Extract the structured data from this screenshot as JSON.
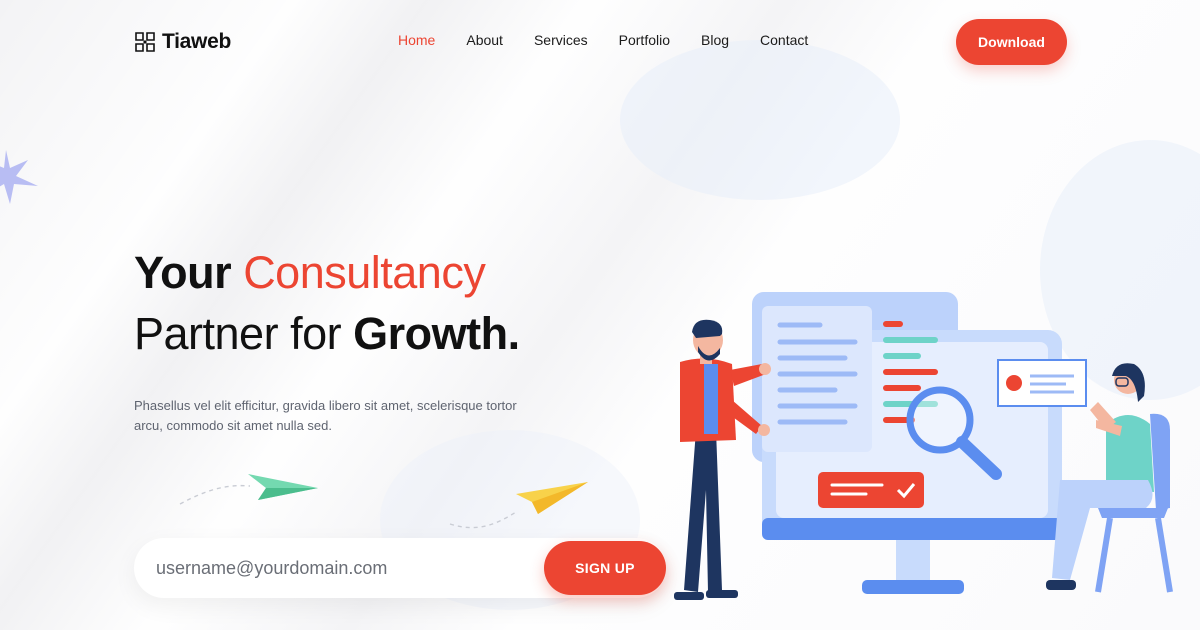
{
  "brand": {
    "name": "Tiaweb"
  },
  "nav": {
    "items": [
      {
        "label": "Home",
        "active": true
      },
      {
        "label": "About",
        "active": false
      },
      {
        "label": "Services",
        "active": false
      },
      {
        "label": "Portfolio",
        "active": false
      },
      {
        "label": "Blog",
        "active": false
      },
      {
        "label": "Contact",
        "active": false
      }
    ],
    "download_label": "Download"
  },
  "hero": {
    "headline_line1_a": "Your",
    "headline_line1_b": "Consultancy",
    "headline_line2_a": "Partner for",
    "headline_line2_b": "Growth.",
    "subtext": "Phasellus vel elit efficitur, gravida libero sit amet, scelerisque tortor arcu, commodo sit amet nulla sed."
  },
  "signup": {
    "placeholder": "username@yourdomain.com",
    "button_label": "SIGN UP"
  },
  "colors": {
    "accent": "#ec4532",
    "text": "#111111",
    "illustration_blue": "#5b8def",
    "teal": "#6ed3c8",
    "navy": "#1e3560"
  },
  "icons": [
    "logo-grid-icon",
    "sparkle-icon",
    "paper-plane-green-icon",
    "paper-plane-yellow-icon",
    "magnifier-icon",
    "checkmark-icon"
  ]
}
